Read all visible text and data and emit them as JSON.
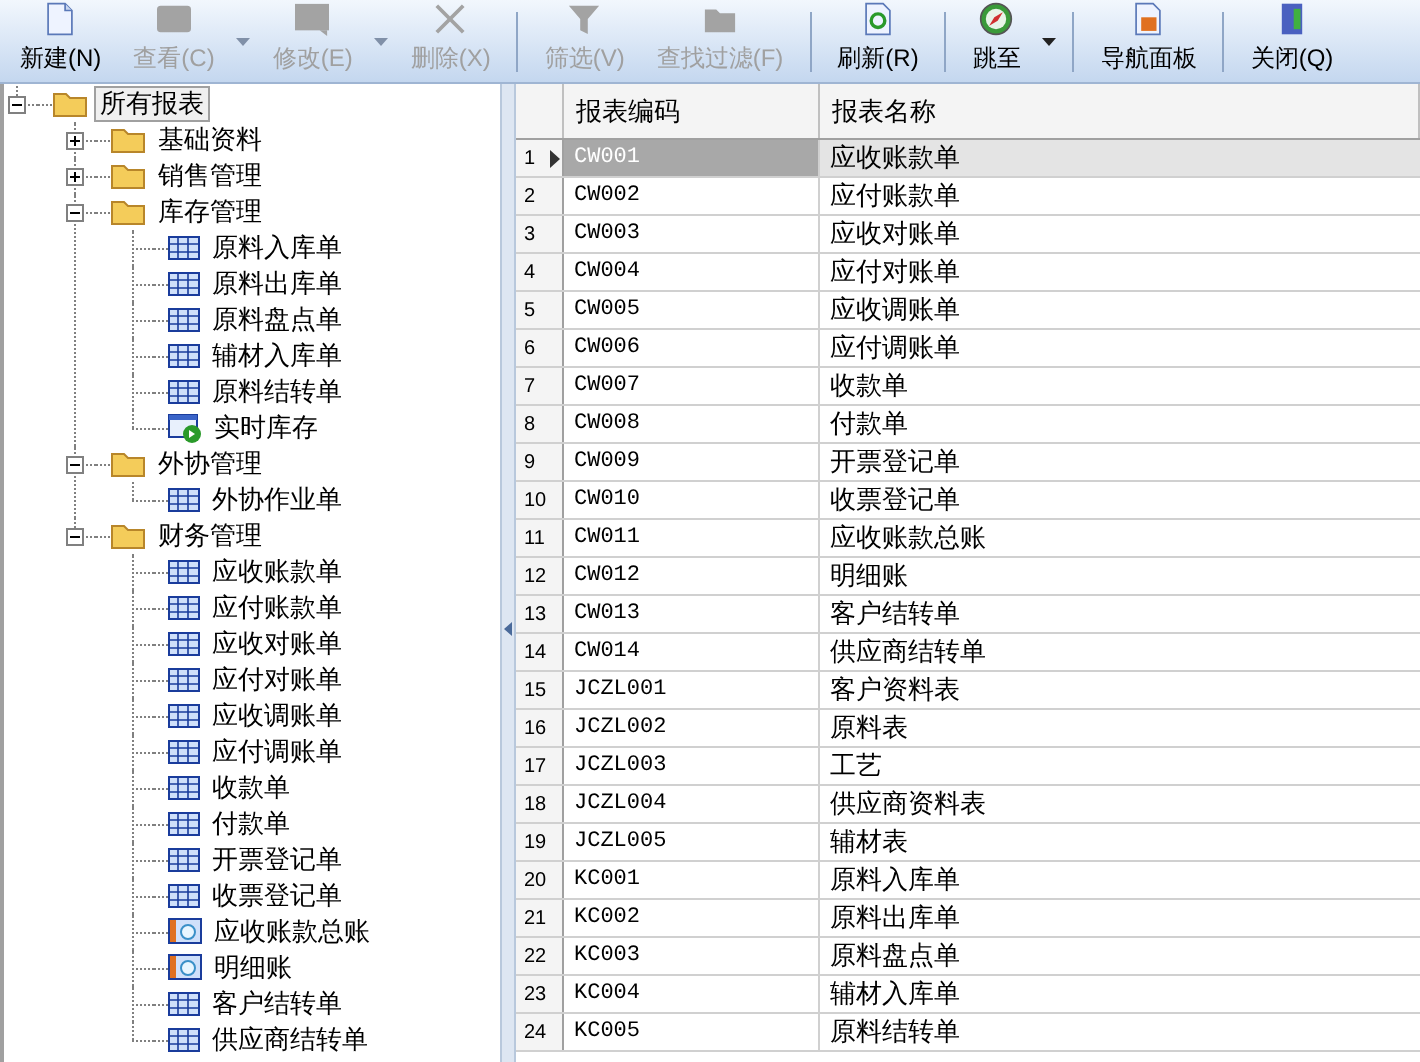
{
  "toolbar": {
    "groups": [
      [
        {
          "label": "新建(N)",
          "disabled": false,
          "dropdown": false
        },
        {
          "label": "查看(C)",
          "disabled": true,
          "dropdown": true
        },
        {
          "label": "修改(E)",
          "disabled": true,
          "dropdown": true
        },
        {
          "label": "删除(X)",
          "disabled": true,
          "dropdown": false
        }
      ],
      [
        {
          "label": "筛选(V)",
          "disabled": true,
          "dropdown": false
        },
        {
          "label": "查找过滤(F)",
          "disabled": true,
          "dropdown": false
        }
      ],
      [
        {
          "label": "刷新(R)",
          "disabled": false,
          "dropdown": false
        }
      ],
      [
        {
          "label": "跳至",
          "disabled": false,
          "dropdown": true
        }
      ],
      [
        {
          "label": "导航面板",
          "disabled": false,
          "dropdown": false
        }
      ],
      [
        {
          "label": "关闭(Q)",
          "disabled": false,
          "dropdown": false
        }
      ]
    ]
  },
  "tree": [
    {
      "label": "所有报表",
      "kind": "folder",
      "selected": true,
      "expanded": true,
      "children": [
        {
          "label": "基础资料",
          "kind": "folder",
          "selected": false,
          "expanded": false
        },
        {
          "label": "销售管理",
          "kind": "folder",
          "selected": false,
          "expanded": false
        },
        {
          "label": "库存管理",
          "kind": "folder",
          "selected": false,
          "expanded": true,
          "children": [
            {
              "label": "原料入库单",
              "kind": "table",
              "selected": false
            },
            {
              "label": "原料出库单",
              "kind": "table",
              "selected": false
            },
            {
              "label": "原料盘点单",
              "kind": "table",
              "selected": false
            },
            {
              "label": "辅材入库单",
              "kind": "table",
              "selected": false
            },
            {
              "label": "原料结转单",
              "kind": "table",
              "selected": false
            },
            {
              "label": "实时库存",
              "kind": "live",
              "selected": false
            }
          ]
        },
        {
          "label": "外协管理",
          "kind": "folder",
          "selected": false,
          "expanded": true,
          "children": [
            {
              "label": "外协作业单",
              "kind": "table",
              "selected": false
            }
          ]
        },
        {
          "label": "财务管理",
          "kind": "folder",
          "selected": false,
          "expanded": true,
          "children": [
            {
              "label": "应收账款单",
              "kind": "table",
              "selected": false
            },
            {
              "label": "应付账款单",
              "kind": "table",
              "selected": false
            },
            {
              "label": "应收对账单",
              "kind": "table",
              "selected": false
            },
            {
              "label": "应付对账单",
              "kind": "table",
              "selected": false
            },
            {
              "label": "应收调账单",
              "kind": "table",
              "selected": false
            },
            {
              "label": "应付调账单",
              "kind": "table",
              "selected": false
            },
            {
              "label": "收款单",
              "kind": "table",
              "selected": false
            },
            {
              "label": "付款单",
              "kind": "table",
              "selected": false
            },
            {
              "label": "开票登记单",
              "kind": "table",
              "selected": false
            },
            {
              "label": "收票登记单",
              "kind": "table",
              "selected": false
            },
            {
              "label": "应收账款总账",
              "kind": "ledger",
              "selected": false
            },
            {
              "label": "明细账",
              "kind": "ledger",
              "selected": false
            },
            {
              "label": "客户结转单",
              "kind": "table",
              "selected": false
            },
            {
              "label": "供应商结转单",
              "kind": "table",
              "selected": false
            }
          ]
        }
      ]
    }
  ],
  "table": {
    "columns": [
      "报表编码",
      "报表名称"
    ],
    "rows": [
      {
        "num": "1",
        "code": "CW001",
        "name": "应收账款单",
        "selected": true
      },
      {
        "num": "2",
        "code": "CW002",
        "name": "应付账款单",
        "selected": false
      },
      {
        "num": "3",
        "code": "CW003",
        "name": "应收对账单",
        "selected": false
      },
      {
        "num": "4",
        "code": "CW004",
        "name": "应付对账单",
        "selected": false
      },
      {
        "num": "5",
        "code": "CW005",
        "name": "应收调账单",
        "selected": false
      },
      {
        "num": "6",
        "code": "CW006",
        "name": "应付调账单",
        "selected": false
      },
      {
        "num": "7",
        "code": "CW007",
        "name": "收款单",
        "selected": false
      },
      {
        "num": "8",
        "code": "CW008",
        "name": "付款单",
        "selected": false
      },
      {
        "num": "9",
        "code": "CW009",
        "name": "开票登记单",
        "selected": false
      },
      {
        "num": "10",
        "code": "CW010",
        "name": "收票登记单",
        "selected": false
      },
      {
        "num": "11",
        "code": "CW011",
        "name": "应收账款总账",
        "selected": false
      },
      {
        "num": "12",
        "code": "CW012",
        "name": "明细账",
        "selected": false
      },
      {
        "num": "13",
        "code": "CW013",
        "name": "客户结转单",
        "selected": false
      },
      {
        "num": "14",
        "code": "CW014",
        "name": "供应商结转单",
        "selected": false
      },
      {
        "num": "15",
        "code": "JCZL001",
        "name": "客户资料表",
        "selected": false
      },
      {
        "num": "16",
        "code": "JCZL002",
        "name": "原料表",
        "selected": false
      },
      {
        "num": "17",
        "code": "JCZL003",
        "name": "工艺",
        "selected": false
      },
      {
        "num": "18",
        "code": "JCZL004",
        "name": "供应商资料表",
        "selected": false
      },
      {
        "num": "19",
        "code": "JCZL005",
        "name": "辅材表",
        "selected": false
      },
      {
        "num": "20",
        "code": "KC001",
        "name": "原料入库单",
        "selected": false
      },
      {
        "num": "21",
        "code": "KC002",
        "name": "原料出库单",
        "selected": false
      },
      {
        "num": "22",
        "code": "KC003",
        "name": "原料盘点单",
        "selected": false
      },
      {
        "num": "23",
        "code": "KC004",
        "name": "辅材入库单",
        "selected": false
      },
      {
        "num": "24",
        "code": "KC005",
        "name": "原料结转单",
        "selected": false
      }
    ]
  }
}
